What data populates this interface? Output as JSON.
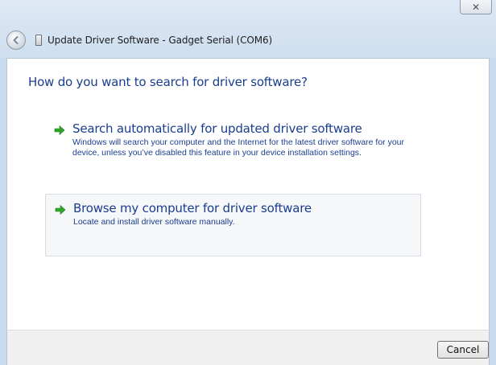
{
  "window": {
    "title": "Update Driver Software - Gadget Serial (COM6)",
    "close_glyph": "✕"
  },
  "content": {
    "question": "How do you want to search for driver software?",
    "options": [
      {
        "title": "Search automatically for updated driver software",
        "description": "Windows will search your computer and the Internet for the latest driver software for your device, unless you’ve disabled this feature in your device installation settings.",
        "icon": "green-arrow-icon"
      },
      {
        "title": "Browse my computer for driver software",
        "description": "Locate and install driver software manually.",
        "icon": "green-arrow-icon"
      }
    ]
  },
  "footer": {
    "cancel_label": "Cancel"
  },
  "colors": {
    "link_blue": "#1a3d8f",
    "arrow_green": "#2fa52a",
    "chrome": "#d7e4f2"
  }
}
